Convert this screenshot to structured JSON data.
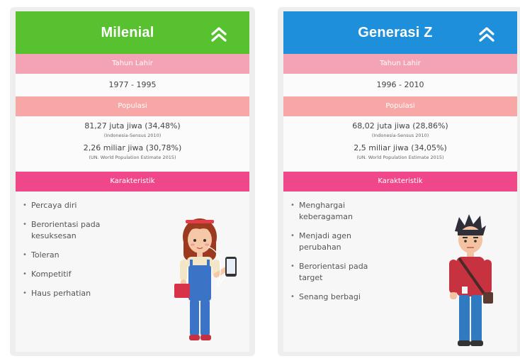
{
  "colors": {
    "milenial_header": "#58c12f",
    "genz_header": "#1e8fda",
    "section_light": "#f4a3b4",
    "section_salmon": "#f7a7a6",
    "section_hot": "#f0478a"
  },
  "cards": {
    "milenial": {
      "title": "Milenial",
      "collapse_icon": "double-chevron-up-icon",
      "birth_label": "Tahun Lahir",
      "birth_value": "1977 - 1995",
      "population_label": "Populasi",
      "pop_indonesia": "81,27 juta jiwa (34,48%)",
      "pop_indonesia_source": "(Indonesia-Sensus 2010)",
      "pop_world": "2,26 miliar jiwa (30,78%)",
      "pop_world_source": "(UN. World Population Estimate 2015)",
      "traits_label": "Karakteristik",
      "traits": [
        "Percaya diri",
        "Berorientasi pada kesuksesan",
        "Toleran",
        "Kompetitif",
        "Haus perhatian"
      ]
    },
    "genz": {
      "title": "Generasi Z",
      "collapse_icon": "double-chevron-up-icon",
      "birth_label": "Tahun Lahir",
      "birth_value": "1996 - 2010",
      "population_label": "Populasi",
      "pop_indonesia": "68,02 juta jiwa (28,86%)",
      "pop_indonesia_source": "(Indonesia-Sensus 2010)",
      "pop_world": "2,5 miliar jiwa (34,05%)",
      "pop_world_source": "(UN. World Population Estimate 2015)",
      "traits_label": "Karakteristik",
      "traits": [
        "Menghargai keberagaman",
        "Menjadi agen perubahan",
        "Berorientasi pada target",
        "Senang berbagi"
      ]
    }
  }
}
